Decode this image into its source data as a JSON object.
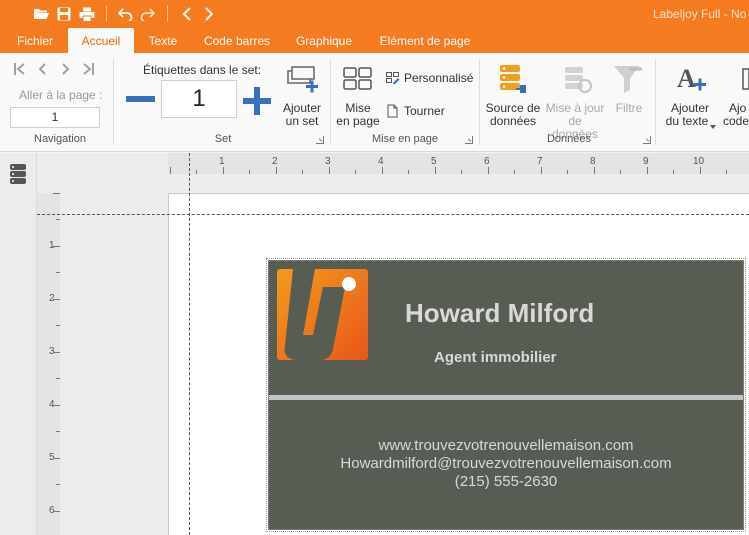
{
  "titlebar": {
    "app_title": "Labeljoy Full - No",
    "bg_color": "#f47b20",
    "quick_access": [
      {
        "icon": "folder-open-icon"
      },
      {
        "icon": "save-icon"
      },
      {
        "icon": "print-icon"
      },
      {
        "icon": "undo-icon"
      },
      {
        "icon": "redo-icon"
      },
      {
        "icon": "back-icon"
      },
      {
        "icon": "forward-icon"
      }
    ]
  },
  "tabs": [
    "Fichier",
    "Accueil",
    "Texte",
    "Code barres",
    "Graphique",
    "Elément de page"
  ],
  "active_tab": "Accueil",
  "ribbon": {
    "navigation": {
      "goto_label": "Aller à la page :",
      "goto_value": "1",
      "group_label": "Navigation"
    },
    "set": {
      "label": "Étiquettes dans le set:",
      "value": "1",
      "add_set_line1": "Ajouter",
      "add_set_line2": "un set",
      "group_label": "Set"
    },
    "layout": {
      "mise_line1": "Mise",
      "mise_line2": "en page",
      "personnalise": "Personnalisé",
      "tourner": "Tourner",
      "group_label": "Mise en page"
    },
    "data": {
      "source_line1": "Source de",
      "source_line2": "données",
      "update_line1": "Mise à jour",
      "update_line2": "de données",
      "filter": "Filtre",
      "group_label": "Données"
    },
    "add_text": {
      "line1": "Ajouter",
      "line2": "du texte"
    },
    "add_code": {
      "line1": "Ajo",
      "line2": "code"
    }
  },
  "rulers": {
    "horizontal": [
      "1",
      "2",
      "3",
      "4",
      "5",
      "6",
      "7",
      "8",
      "9",
      "10"
    ],
    "vertical": [
      "1",
      "2",
      "3",
      "4",
      "5",
      "6"
    ]
  },
  "card": {
    "name": "Howard Milford",
    "job": "Agent immobilier",
    "website": "www.trouvezvotrenouvellemaison.com",
    "email": "Howardmilford@trouvezvotrenouvellemaison.com",
    "phone": "(215) 555-2630",
    "bg_color": "#575d53",
    "logo_color": "#f07a1a"
  }
}
